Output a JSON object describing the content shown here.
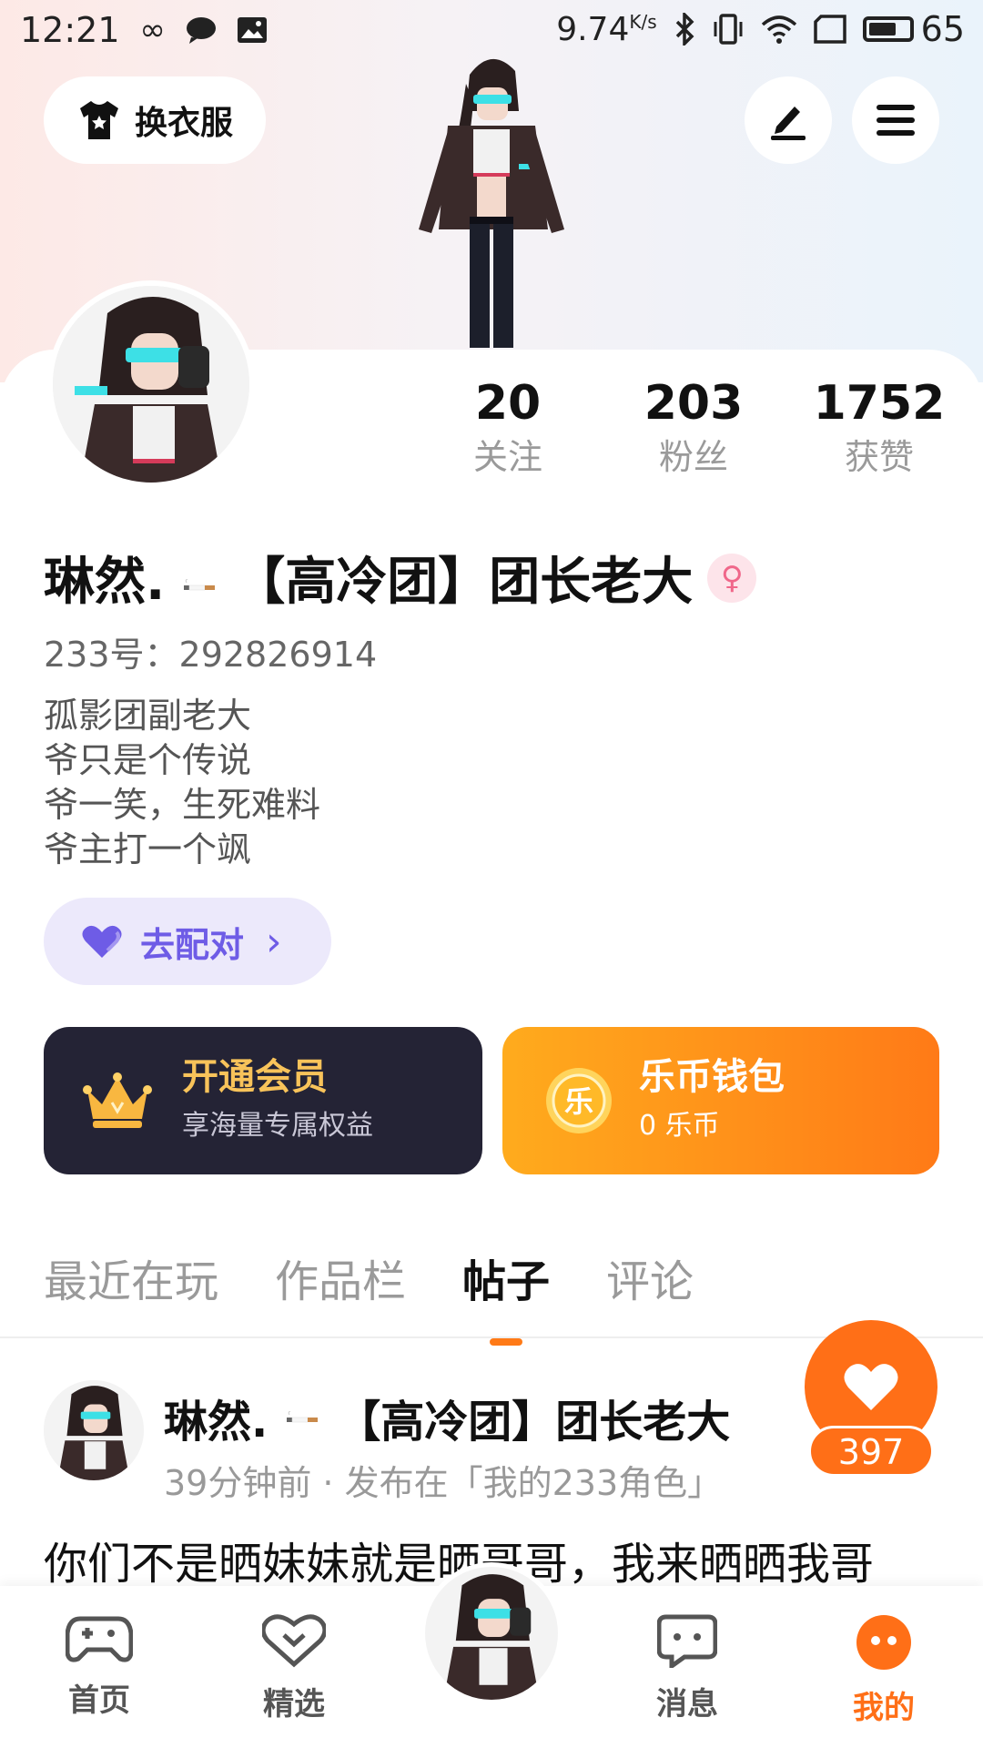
{
  "status_bar": {
    "time": "12:21",
    "net_speed": "9.74",
    "net_unit": "K/s",
    "battery": "65"
  },
  "header": {
    "dress_up_label": "换衣服",
    "icons": [
      "tshirt-icon",
      "edit-icon",
      "menu-icon"
    ]
  },
  "stats": [
    {
      "value": "20",
      "label": "关注"
    },
    {
      "value": "203",
      "label": "粉丝"
    },
    {
      "value": "1752",
      "label": "获赞"
    }
  ],
  "profile": {
    "name_part1": "琳然.",
    "name_part2": "【高冷团】团长老大",
    "gender_symbol": "♀",
    "id_text": "233号：292826914",
    "bio": [
      "孤影团副老大",
      "爷只是个传说",
      "爷一笑，生死难料",
      "爷主打一个飒"
    ]
  },
  "match_button": {
    "label": "去配对",
    "chevron": "›"
  },
  "vip_card": {
    "title": "开通会员",
    "subtitle": "享海量专属权益",
    "accent": "#f8c35a"
  },
  "coin_card": {
    "title": "乐币钱包",
    "subtitle": "0 乐币",
    "coin_char": "乐"
  },
  "tabs": [
    {
      "label": "最近在玩",
      "active": false
    },
    {
      "label": "作品栏",
      "active": false
    },
    {
      "label": "帖子",
      "active": true
    },
    {
      "label": "评论",
      "active": false
    }
  ],
  "post": {
    "author_part1": "琳然.",
    "author_part2": "【高冷团】团长老大",
    "meta": "39分钟前 · 发布在「我的233角色」",
    "text": "你们不是晒妹妹就是晒哥哥，我来晒晒我哥",
    "likes": "397"
  },
  "bottom_nav": [
    {
      "label": "首页",
      "icon": "gamepad-icon",
      "active": false
    },
    {
      "label": "精选",
      "icon": "heart-chat-icon",
      "active": false
    },
    {
      "label": "消息",
      "icon": "message-icon",
      "active": false
    },
    {
      "label": "我的",
      "icon": "face-icon",
      "active": true
    }
  ],
  "colors": {
    "accent_orange": "#ff6f17",
    "match_purple": "#6e5ce6",
    "vip_dark": "#242335"
  }
}
